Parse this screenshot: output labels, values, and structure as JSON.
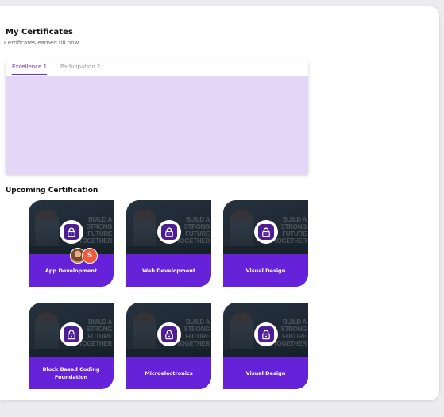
{
  "header": {
    "title": "My Certificates",
    "subtitle": "Certificates earned till now"
  },
  "certificates": {
    "tabs": [
      {
        "label": "Excellence 1"
      },
      {
        "label": "Participation 2"
      }
    ],
    "active_tab": "Excellence 1"
  },
  "upcoming": {
    "title": "Upcoming Certification",
    "poster_text": "BUILD A STRONG FUTURE TOGETHER",
    "courses": [
      {
        "label": "App Development"
      },
      {
        "label": "Web Development"
      },
      {
        "label": "Visual Design"
      },
      {
        "label": "Block Based Coding Foundation"
      },
      {
        "label": "Microelectronics"
      },
      {
        "label": "Visual Design"
      }
    ],
    "participant_initial": "S"
  },
  "colors": {
    "accent": "#6522d9",
    "lock_bg": "#4c1d95",
    "cert_area": "#e3d7f7",
    "avatar_initial_bg": "#ef5a3c"
  }
}
